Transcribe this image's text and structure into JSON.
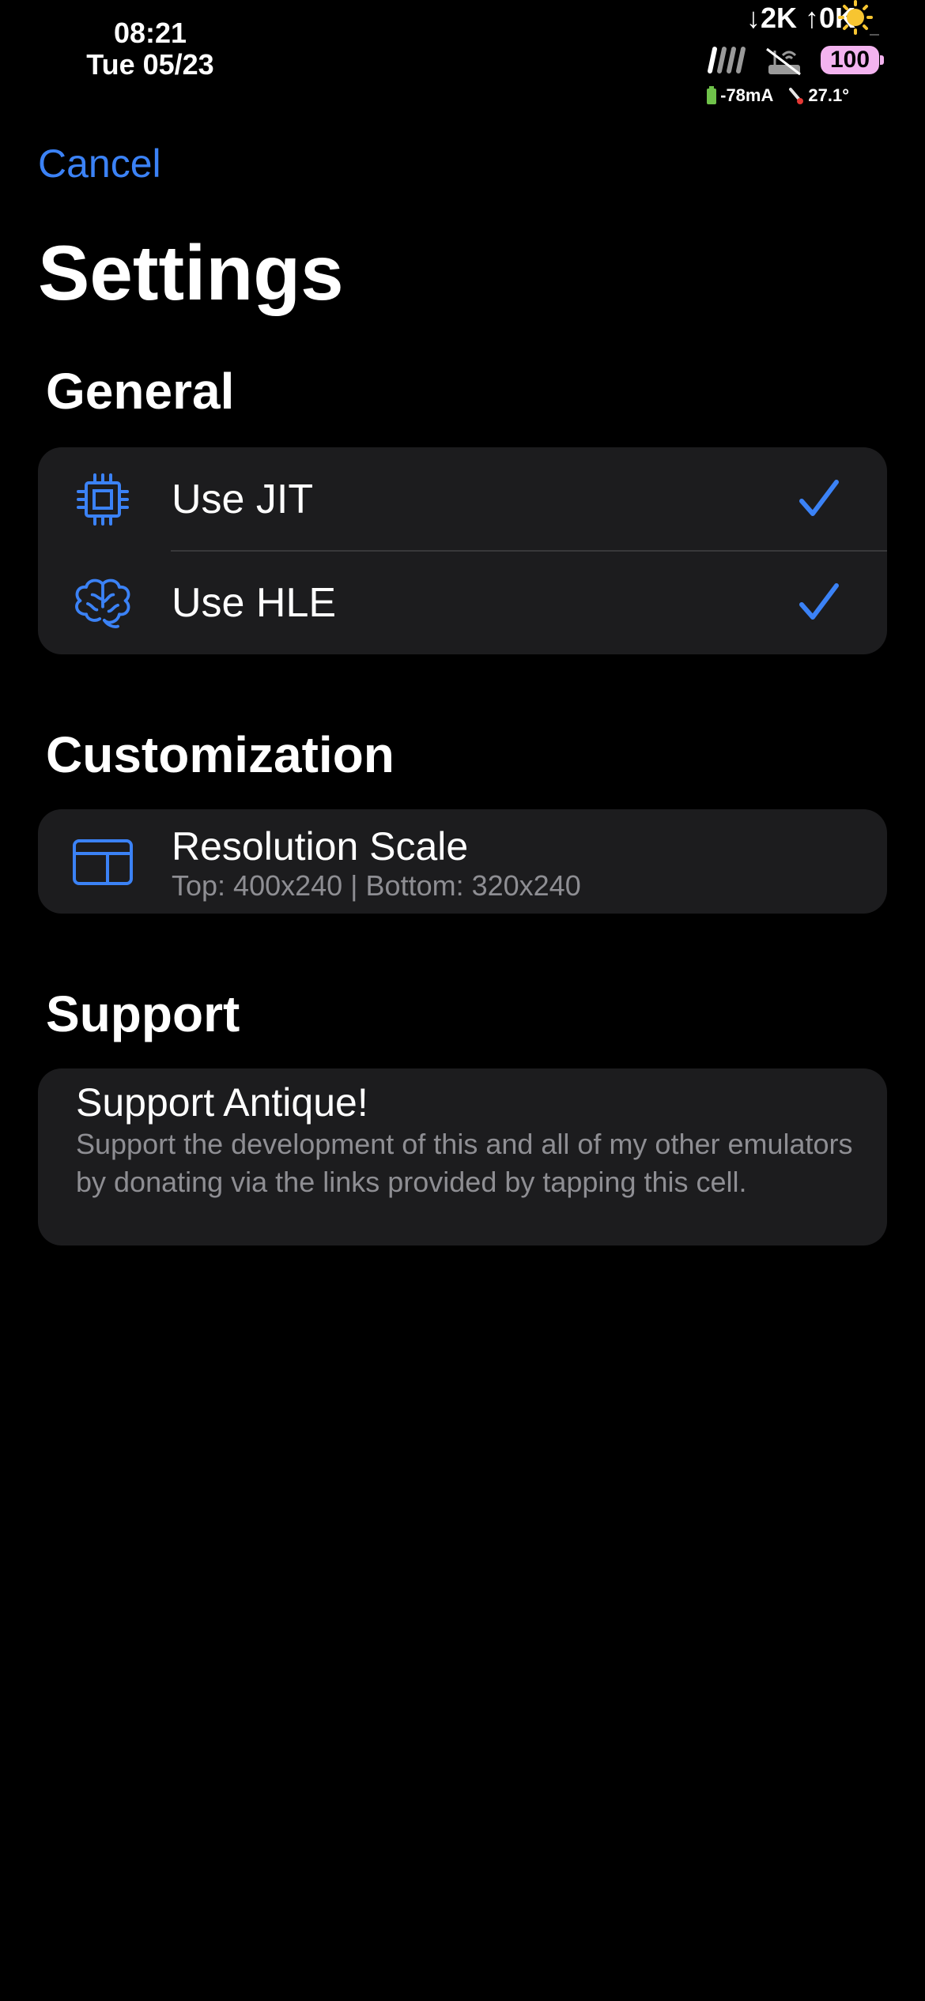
{
  "status_bar": {
    "time": "08:21",
    "date": "Tue 05/23",
    "download": "↓2K",
    "upload": "↑0K",
    "battery_level": "100",
    "current": "-78mA",
    "temperature": "27.1°",
    "accent_battery_color": "#f3b3ef"
  },
  "nav": {
    "cancel_label": "Cancel",
    "title": "Settings"
  },
  "sections": {
    "general": {
      "title": "General",
      "items": [
        {
          "label": "Use JIT",
          "icon": "cpu-icon",
          "checked": true
        },
        {
          "label": "Use HLE",
          "icon": "brain-icon",
          "checked": true
        }
      ]
    },
    "customization": {
      "title": "Customization",
      "resolution_title": "Resolution Scale",
      "resolution_subtitle": "Top: 400x240 | Bottom: 320x240",
      "icon": "screen-layout-icon"
    },
    "support": {
      "title": "Support",
      "cell_title": "Support Antique!",
      "cell_description": "Support the development of this and all of my other emulators by donating via the links provided by tapping this cell."
    }
  },
  "colors": {
    "accent": "#3b82f6",
    "cell_background": "#1c1c1e",
    "secondary_text": "#8e8e93"
  }
}
